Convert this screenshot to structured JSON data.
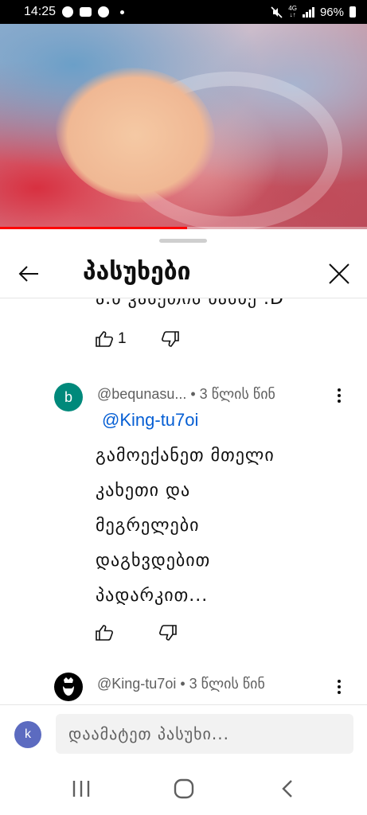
{
  "status_bar": {
    "time": "14:25",
    "network_top": "4G",
    "network_bottom": "↓↑",
    "battery": "96%",
    "icons": [
      "chrome-icon",
      "youtube-icon",
      "chrome-icon",
      "dot-icon",
      "mute-icon",
      "signal-icon",
      "battery-icon"
    ]
  },
  "video": {
    "progress": 0.51,
    "progress_color": "#ff0000"
  },
  "header": {
    "title": "პასუხები",
    "back_icon": "arrow-left-icon",
    "close_icon": "close-icon"
  },
  "replies": [
    {
      "body_clipped": "ა.ნ კასეთის ნასხე .D",
      "likes": "1"
    },
    {
      "avatar_letter": "b",
      "avatar_color": "#00897b",
      "handle": "@bequnasu...",
      "time": "• 3 წლის წინ",
      "mention": "@King-tu7oi",
      "body_lines": [
        "გამოექანეთ მთელი",
        "კახეთი და",
        "მეგრელები",
        "დაგხვდებით",
        "პადარკით..."
      ],
      "likes": ""
    },
    {
      "avatar_color": "#000000",
      "handle": "@King-tu7oi",
      "time": "• 3 წლის წინ"
    }
  ],
  "composer": {
    "avatar_letter": "k",
    "avatar_color": "#5c6bc0",
    "placeholder": "დაამატეთ პასუხი..."
  },
  "nav": {
    "recents_icon": "recents-icon",
    "home_icon": "home-icon",
    "back_icon": "nav-back-icon"
  }
}
